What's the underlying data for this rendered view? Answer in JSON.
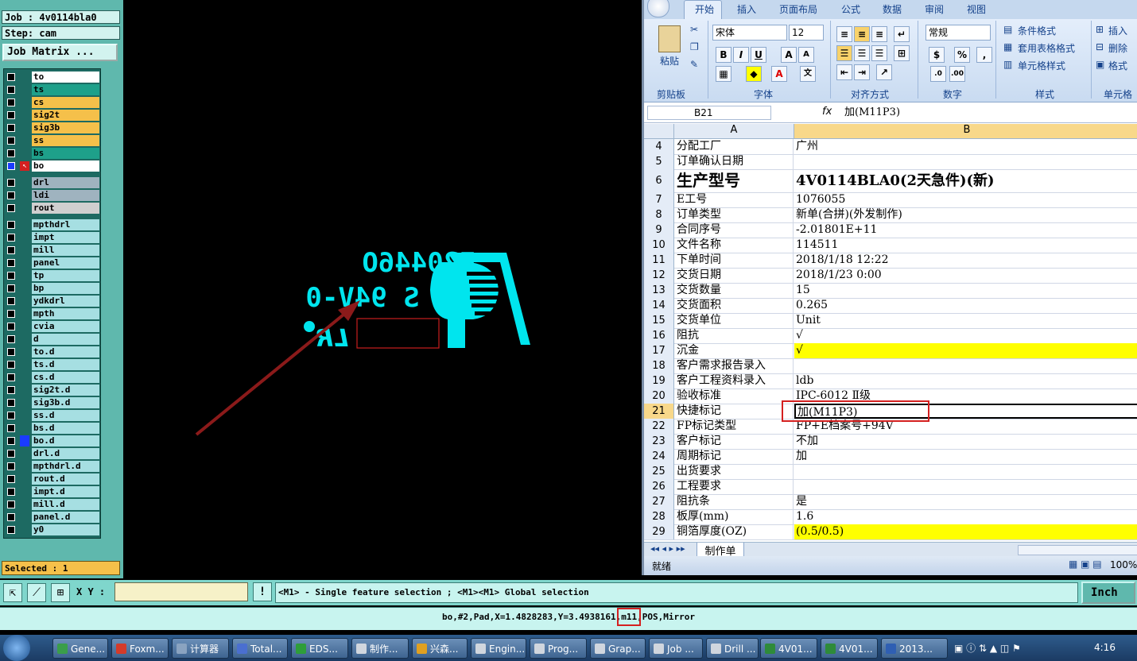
{
  "cam": {
    "job": "Job : 4v0114bla0",
    "step": "Step: cam",
    "job_matrix": "Job Matrix ...",
    "layers": [
      {
        "name": "to",
        "color": "#ffffff"
      },
      {
        "name": "ts",
        "color": "#1ea08a"
      },
      {
        "name": "cs",
        "color": "#f5c04a"
      },
      {
        "name": "sig2t",
        "color": "#f5c04a"
      },
      {
        "name": "sig3b",
        "color": "#f5c04a"
      },
      {
        "name": "ss",
        "color": "#f5c04a"
      },
      {
        "name": "bs",
        "color": "#1ea08a"
      },
      {
        "name": "bo",
        "color": "#ffffff",
        "active": true
      },
      {
        "name": "drl",
        "color": "#9fb3bf"
      },
      {
        "name": "ldi",
        "color": "#9fb3bf"
      },
      {
        "name": "rout",
        "color": "#cfcfcf"
      },
      {
        "name": "mpthdrl",
        "color": "#a6dfe2"
      },
      {
        "name": "impt",
        "color": "#a6dfe2"
      },
      {
        "name": "mill",
        "color": "#a6dfe2"
      },
      {
        "name": "panel",
        "color": "#a6dfe2"
      },
      {
        "name": "tp",
        "color": "#a6dfe2"
      },
      {
        "name": "bp",
        "color": "#a6dfe2"
      },
      {
        "name": "ydkdrl",
        "color": "#a6dfe2"
      },
      {
        "name": "mpth",
        "color": "#a6dfe2"
      },
      {
        "name": "cvia",
        "color": "#a6dfe2"
      },
      {
        "name": "d",
        "color": "#a6dfe2"
      },
      {
        "name": "to.d",
        "color": "#a6dfe2"
      },
      {
        "name": "ts.d",
        "color": "#a6dfe2"
      },
      {
        "name": "cs.d",
        "color": "#a6dfe2"
      },
      {
        "name": "sig2t.d",
        "color": "#a6dfe2"
      },
      {
        "name": "sig3b.d",
        "color": "#a6dfe2"
      },
      {
        "name": "ss.d",
        "color": "#a6dfe2"
      },
      {
        "name": "bs.d",
        "color": "#a6dfe2"
      },
      {
        "name": "bo.d",
        "color": "#a6dfe2",
        "marker": true
      },
      {
        "name": "drl.d",
        "color": "#a6dfe2"
      },
      {
        "name": "mpthdrl.d",
        "color": "#a6dfe2"
      },
      {
        "name": "rout.d",
        "color": "#a6dfe2"
      },
      {
        "name": "impt.d",
        "color": "#a6dfe2"
      },
      {
        "name": "mill.d",
        "color": "#a6dfe2"
      },
      {
        "name": "panel.d",
        "color": "#a6dfe2"
      },
      {
        "name": "y0",
        "color": "#a6dfe2"
      }
    ],
    "selected": "Selected : 1",
    "canvas_text_line1": "E20446O",
    "canvas_text_line2": "M11 S 94V-0",
    "canvas_logo_text": "LR",
    "xy_label": "X Y :",
    "xy_value": "",
    "hint": "<M1> - Single feature selection ; <M1><M1> Global selection",
    "unit": "Inch",
    "coord_prefix": "bo,#2,Pad,X=1.4828283,Y=3.4938161,",
    "coord_highlight": "m11",
    "coord_suffix": ",POS,Mirror",
    "accent": "#00e5ee"
  },
  "excel": {
    "tabs": [
      "开始",
      "插入",
      "页面布局",
      "公式",
      "数据",
      "审阅",
      "视图"
    ],
    "clipboard": {
      "paste": "粘贴",
      "group": "剪贴板"
    },
    "font": {
      "name": "宋体",
      "size": "12",
      "group": "字体",
      "bold": "B",
      "italic": "I",
      "underline": "U"
    },
    "align_group": "对齐方式",
    "number": {
      "format": "常规",
      "group": "数字",
      "percent": "%"
    },
    "styles": {
      "cond": "条件格式",
      "table": "套用表格格式",
      "cell": "单元格样式",
      "group": "样式"
    },
    "cells": {
      "insert": "插入",
      "delete": "删除",
      "format": "格式",
      "group": "单元格"
    },
    "name_box": "B21",
    "fx": "fx",
    "formula": "加(M11P3)",
    "col_a": "A",
    "col_b": "B",
    "rows": [
      {
        "n": "4",
        "a": "分配工厂",
        "b": "广州"
      },
      {
        "n": "5",
        "a": "订单确认日期",
        "b": ""
      },
      {
        "n": "6",
        "a": "生产型号",
        "b": "4V0114BLA0(2天急件)(新)",
        "big": true
      },
      {
        "n": "7",
        "a": "E工号",
        "b": "1076055"
      },
      {
        "n": "8",
        "a": "订单类型",
        "b": "新单(合拼)(外发制作)"
      },
      {
        "n": "9",
        "a": "合同序号",
        "b": "-2.01801E+11"
      },
      {
        "n": "10",
        "a": "文件名称",
        "b": "114511"
      },
      {
        "n": "11",
        "a": "下单时间",
        "b": "2018/1/18 12:22"
      },
      {
        "n": "12",
        "a": "交货日期",
        "b": "2018/1/23 0:00"
      },
      {
        "n": "13",
        "a": "交货数量",
        "b": "15"
      },
      {
        "n": "14",
        "a": "交货面积",
        "b": "0.265"
      },
      {
        "n": "15",
        "a": "交货单位",
        "b": "Unit"
      },
      {
        "n": "16",
        "a": "阻抗",
        "b": "√"
      },
      {
        "n": "17",
        "a": "沉金",
        "b": "√",
        "yellow": true
      },
      {
        "n": "18",
        "a": "客户需求报告录入",
        "b": ""
      },
      {
        "n": "19",
        "a": "客户工程资料录入",
        "b": "ldb"
      },
      {
        "n": "20",
        "a": "验收标准",
        "b": "IPC-6012 Ⅱ级"
      },
      {
        "n": "21",
        "a": "快捷标记",
        "b": "加(M11P3)",
        "active": true
      },
      {
        "n": "22",
        "a": "FP标记类型",
        "b": "FP+E档案号+94V"
      },
      {
        "n": "23",
        "a": "客户标记",
        "b": "不加"
      },
      {
        "n": "24",
        "a": "周期标记",
        "b": "加"
      },
      {
        "n": "25",
        "a": "出货要求",
        "b": ""
      },
      {
        "n": "26",
        "a": "工程要求",
        "b": ""
      },
      {
        "n": "27",
        "a": "阻抗条",
        "b": "是"
      },
      {
        "n": "28",
        "a": "板厚(mm)",
        "b": "1.6"
      },
      {
        "n": "29",
        "a": "铜箔厚度(OZ)",
        "b": "(0.5/0.5)",
        "yellow": true
      }
    ],
    "sheet_tab": "制作单",
    "status": "就绪",
    "zoom": "100%"
  },
  "taskbar": {
    "items": [
      {
        "label": "Gene...",
        "color": "#3a9e4a"
      },
      {
        "label": "Foxm...",
        "color": "#d43b2a"
      },
      {
        "label": "计算器",
        "color": "#8aa3c0"
      },
      {
        "label": "Total...",
        "color": "#4a6fd0"
      },
      {
        "label": "EDS...",
        "color": "#2e9e3a"
      },
      {
        "label": "制作...",
        "color": "#d0d6de"
      },
      {
        "label": "兴森...",
        "color": "#e0a020"
      },
      {
        "label": "Engin...",
        "color": "#d0d6de"
      },
      {
        "label": "Prog...",
        "color": "#d0d6de"
      },
      {
        "label": "Grap...",
        "color": "#d0d6de"
      },
      {
        "label": "Job ...",
        "color": "#d0d6de"
      },
      {
        "label": "Drill ...",
        "color": "#d0d6de"
      },
      {
        "label": "4V01...",
        "color": "#2e8b3a"
      },
      {
        "label": "4V01...",
        "color": "#2e8b3a"
      },
      {
        "label": "2013...",
        "color": "#2f5fb3"
      }
    ],
    "clock": "4:16"
  }
}
